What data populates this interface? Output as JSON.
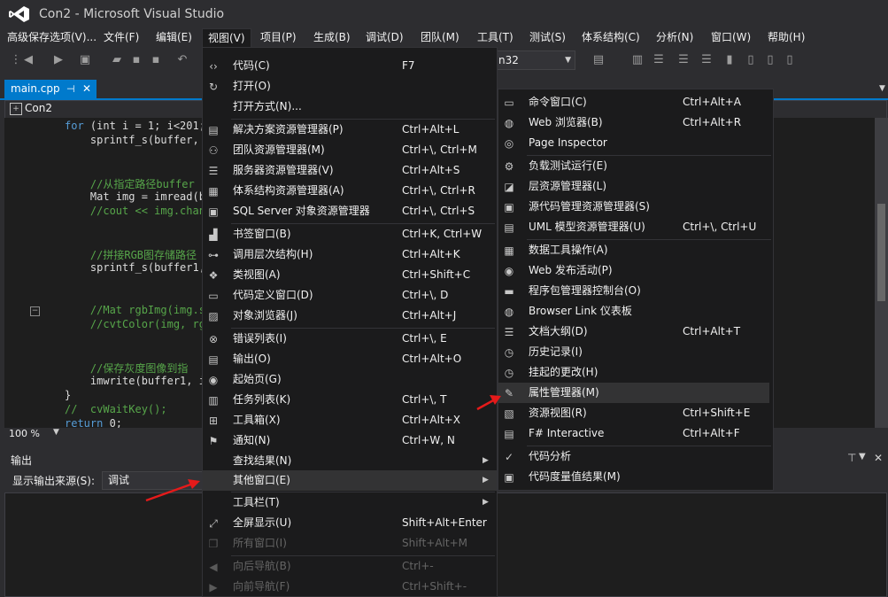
{
  "window": {
    "title": "Con2 - Microsoft Visual Studio"
  },
  "menubar": {
    "items": [
      "高级保存选项(V)...",
      "文件(F)",
      "编辑(E)",
      "视图(V)",
      "项目(P)",
      "生成(B)",
      "调试(D)",
      "团队(M)",
      "工具(T)",
      "测试(S)",
      "体系结构(C)",
      "分析(N)",
      "窗口(W)",
      "帮助(H)"
    ],
    "active": "视图(V)"
  },
  "toolbar": {
    "platform": "n32"
  },
  "editor": {
    "tab": "main.cpp",
    "nav": "Con2",
    "zoom": "100 %",
    "lines": [
      {
        "kw": "for",
        "text": " (int i = 1; i<201;"
      },
      {
        "text": "    sprintf_s(buffer,"
      },
      {
        "cm": "    //从指定路径buffer"
      },
      {
        "text": "    Mat img = imread(b"
      },
      {
        "cm": "    //cout << img.chan"
      },
      {
        "cm": "    //拼接RGB图存储路径"
      },
      {
        "text": "    sprintf_s(buffer1,"
      },
      {
        "cm": "    //Mat rgbImg(img.s"
      },
      {
        "cm": "    //cvtColor(img, rg"
      },
      {
        "cm": "    //保存灰度图像到指"
      },
      {
        "text": "    imwrite(buffer1, i"
      },
      {
        "text": "}"
      },
      {
        "cm": "//  cvWaitKey();"
      },
      {
        "kw": "return",
        "text": " 0;"
      }
    ]
  },
  "output": {
    "title": "输出",
    "source_label": "显示输出来源(S):",
    "source_value": "调试"
  },
  "view_menu": {
    "items": [
      {
        "icon": "code-icon",
        "glyph": "<>",
        "label": "代码(C)",
        "shortcut": "F7"
      },
      {
        "icon": "open-icon",
        "glyph": "↻",
        "label": "打开(O)",
        "shortcut": ""
      },
      {
        "icon": "",
        "glyph": "",
        "label": "打开方式(N)...",
        "shortcut": ""
      },
      {
        "icon": "solution-explorer-icon",
        "glyph": "▤",
        "label": "解决方案资源管理器(P)",
        "shortcut": "Ctrl+Alt+L"
      },
      {
        "icon": "team-explorer-icon",
        "glyph": "⚇",
        "label": "团队资源管理器(M)",
        "shortcut": "Ctrl+\\, Ctrl+M"
      },
      {
        "icon": "server-explorer-icon",
        "glyph": "☰",
        "label": "服务器资源管理器(V)",
        "shortcut": "Ctrl+Alt+S"
      },
      {
        "icon": "architecture-explorer-icon",
        "glyph": "▦",
        "label": "体系结构资源管理器(A)",
        "shortcut": "Ctrl+\\, Ctrl+R"
      },
      {
        "icon": "sql-server-icon",
        "glyph": "▣",
        "label": "SQL Server 对象资源管理器",
        "shortcut": "Ctrl+\\, Ctrl+S"
      },
      {
        "icon": "bookmark-icon",
        "glyph": "▟",
        "label": "书签窗口(B)",
        "shortcut": "Ctrl+K, Ctrl+W"
      },
      {
        "icon": "call-hierarchy-icon",
        "glyph": "⊶",
        "label": "调用层次结构(H)",
        "shortcut": "Ctrl+Alt+K"
      },
      {
        "icon": "class-view-icon",
        "glyph": "❖",
        "label": "类视图(A)",
        "shortcut": "Ctrl+Shift+C"
      },
      {
        "icon": "code-definition-icon",
        "glyph": "▭",
        "label": "代码定义窗口(D)",
        "shortcut": "Ctrl+\\, D"
      },
      {
        "icon": "object-browser-icon",
        "glyph": "▨",
        "label": "对象浏览器(J)",
        "shortcut": "Ctrl+Alt+J"
      },
      {
        "icon": "error-list-icon",
        "glyph": "⊗",
        "label": "错误列表(I)",
        "shortcut": "Ctrl+\\, E"
      },
      {
        "icon": "output-icon",
        "glyph": "▤",
        "label": "输出(O)",
        "shortcut": "Ctrl+Alt+O"
      },
      {
        "icon": "start-page-icon",
        "glyph": "◉",
        "label": "起始页(G)",
        "shortcut": ""
      },
      {
        "icon": "task-list-icon",
        "glyph": "▥",
        "label": "任务列表(K)",
        "shortcut": "Ctrl+\\, T"
      },
      {
        "icon": "toolbox-icon",
        "glyph": "⊞",
        "label": "工具箱(X)",
        "shortcut": "Ctrl+Alt+X"
      },
      {
        "icon": "notification-icon",
        "glyph": "⚑",
        "label": "通知(N)",
        "shortcut": "Ctrl+W, N"
      },
      {
        "icon": "",
        "glyph": "",
        "label": "查找结果(N)",
        "shortcut": ""
      },
      {
        "icon": "",
        "glyph": "",
        "label": "其他窗口(E)",
        "shortcut": ""
      },
      {
        "icon": "",
        "glyph": "",
        "label": "工具栏(T)",
        "shortcut": ""
      },
      {
        "icon": "full-screen-icon",
        "glyph": "⤢",
        "label": "全屏显示(U)",
        "shortcut": "Shift+Alt+Enter"
      },
      {
        "icon": "all-windows-icon",
        "glyph": "❐",
        "label": "所有窗口(I)",
        "shortcut": "Shift+Alt+M"
      },
      {
        "icon": "navigate-back-icon",
        "glyph": "◀",
        "label": "向后导航(B)",
        "shortcut": "Ctrl+-"
      },
      {
        "icon": "navigate-forward-icon",
        "glyph": "▶",
        "label": "向前导航(F)",
        "shortcut": "Ctrl+Shift+-"
      }
    ]
  },
  "other_windows_menu": {
    "items": [
      {
        "icon": "command-window-icon",
        "glyph": "▭",
        "label": "命令窗口(C)",
        "shortcut": "Ctrl+Alt+A"
      },
      {
        "icon": "web-browser-icon",
        "glyph": "◍",
        "label": "Web 浏览器(B)",
        "shortcut": "Ctrl+Alt+R"
      },
      {
        "icon": "page-inspector-icon",
        "glyph": "◎",
        "label": "Page Inspector",
        "shortcut": ""
      },
      {
        "icon": "load-test-icon",
        "glyph": "⚙",
        "label": "负载测试运行(E)",
        "shortcut": ""
      },
      {
        "icon": "layer-explorer-icon",
        "glyph": "◪",
        "label": "层资源管理器(L)",
        "shortcut": ""
      },
      {
        "icon": "source-control-icon",
        "glyph": "▣",
        "label": "源代码管理资源管理器(S)",
        "shortcut": ""
      },
      {
        "icon": "uml-explorer-icon",
        "glyph": "▤",
        "label": "UML 模型资源管理器(U)",
        "shortcut": "Ctrl+\\, Ctrl+U"
      },
      {
        "icon": "data-tools-icon",
        "glyph": "▦",
        "label": "数据工具操作(A)",
        "shortcut": ""
      },
      {
        "icon": "web-publish-icon",
        "glyph": "◉",
        "label": "Web 发布活动(P)",
        "shortcut": ""
      },
      {
        "icon": "package-manager-icon",
        "glyph": "▬",
        "label": "程序包管理器控制台(O)",
        "shortcut": ""
      },
      {
        "icon": "browser-link-icon",
        "glyph": "◍",
        "label": "Browser Link 仪表板",
        "shortcut": ""
      },
      {
        "icon": "document-outline-icon",
        "glyph": "☰",
        "label": "文档大纲(D)",
        "shortcut": "Ctrl+Alt+T"
      },
      {
        "icon": "history-icon",
        "glyph": "◷",
        "label": "历史记录(I)",
        "shortcut": ""
      },
      {
        "icon": "pending-changes-icon",
        "glyph": "◷",
        "label": "挂起的更改(H)",
        "shortcut": ""
      },
      {
        "icon": "property-manager-icon",
        "glyph": "✎",
        "label": "属性管理器(M)",
        "shortcut": ""
      },
      {
        "icon": "resource-view-icon",
        "glyph": "▧",
        "label": "资源视图(R)",
        "shortcut": "Ctrl+Shift+E"
      },
      {
        "icon": "fsharp-interactive-icon",
        "glyph": "▤",
        "label": "F# Interactive",
        "shortcut": "Ctrl+Alt+F"
      },
      {
        "icon": "code-analysis-icon",
        "glyph": "✓",
        "label": "代码分析",
        "shortcut": ""
      },
      {
        "icon": "code-metrics-icon",
        "glyph": "▣",
        "label": "代码度量值结果(M)",
        "shortcut": ""
      }
    ]
  },
  "colors": {
    "accent": "#007acc",
    "background": "#2d2d30",
    "editor": "#1e1e1e",
    "annotation_arrow": "#e51a1a"
  }
}
